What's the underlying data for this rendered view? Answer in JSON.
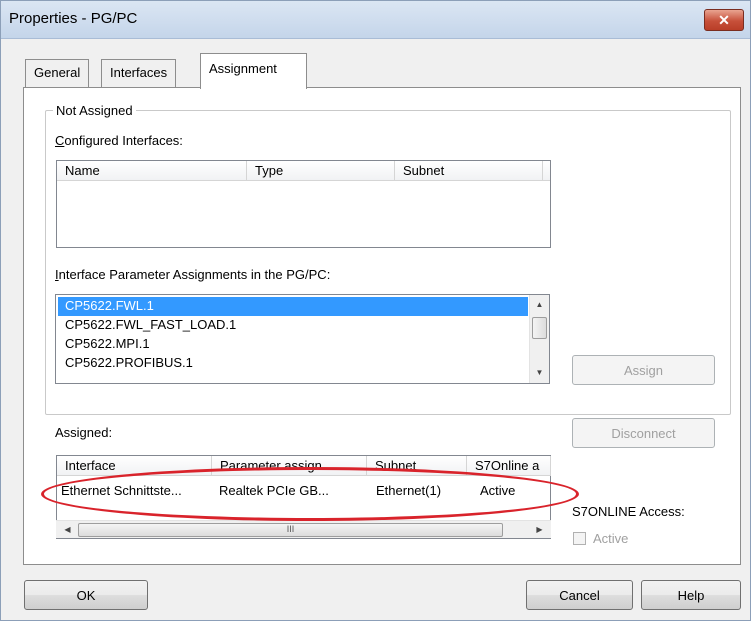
{
  "window": {
    "title": "Properties - PG/PC",
    "close_glyph": "✕"
  },
  "tabs": [
    {
      "label": "General",
      "active": false
    },
    {
      "label": "Interfaces",
      "active": false
    },
    {
      "label": "Assignment",
      "active": true
    }
  ],
  "not_assigned": {
    "group_title": "Not Assigned",
    "configured_label": "Configured Interfaces:",
    "configured_columns": [
      "Name",
      "Type",
      "Subnet"
    ],
    "param_label": "Interface Parameter Assignments in the PG/PC:",
    "param_items": [
      {
        "label": "CP5622.FWL.1",
        "selected": true
      },
      {
        "label": "CP5622.FWL_FAST_LOAD.1",
        "selected": false
      },
      {
        "label": "CP5622.MPI.1",
        "selected": false
      },
      {
        "label": "CP5622.PROFIBUS.1",
        "selected": false
      }
    ]
  },
  "buttons": {
    "assign": "Assign",
    "disconnect": "Disconnect",
    "ok": "OK",
    "cancel": "Cancel",
    "help": "Help"
  },
  "assigned": {
    "label": "Assigned:",
    "columns": [
      "Interface",
      "Parameter assign...",
      "Subnet",
      "S7Online a"
    ],
    "rows": [
      {
        "interface": "Ethernet Schnittste...",
        "parameter": "Realtek PCIe GB...",
        "subnet": "Ethernet(1)",
        "s7online": "Active"
      }
    ],
    "scroll_grip": "III"
  },
  "s7online": {
    "label": "S7ONLINE Access:",
    "checkbox_label": "Active",
    "checked": false
  },
  "colors": {
    "selection": "#3399ff",
    "highlight_ellipse": "#d9232b"
  }
}
